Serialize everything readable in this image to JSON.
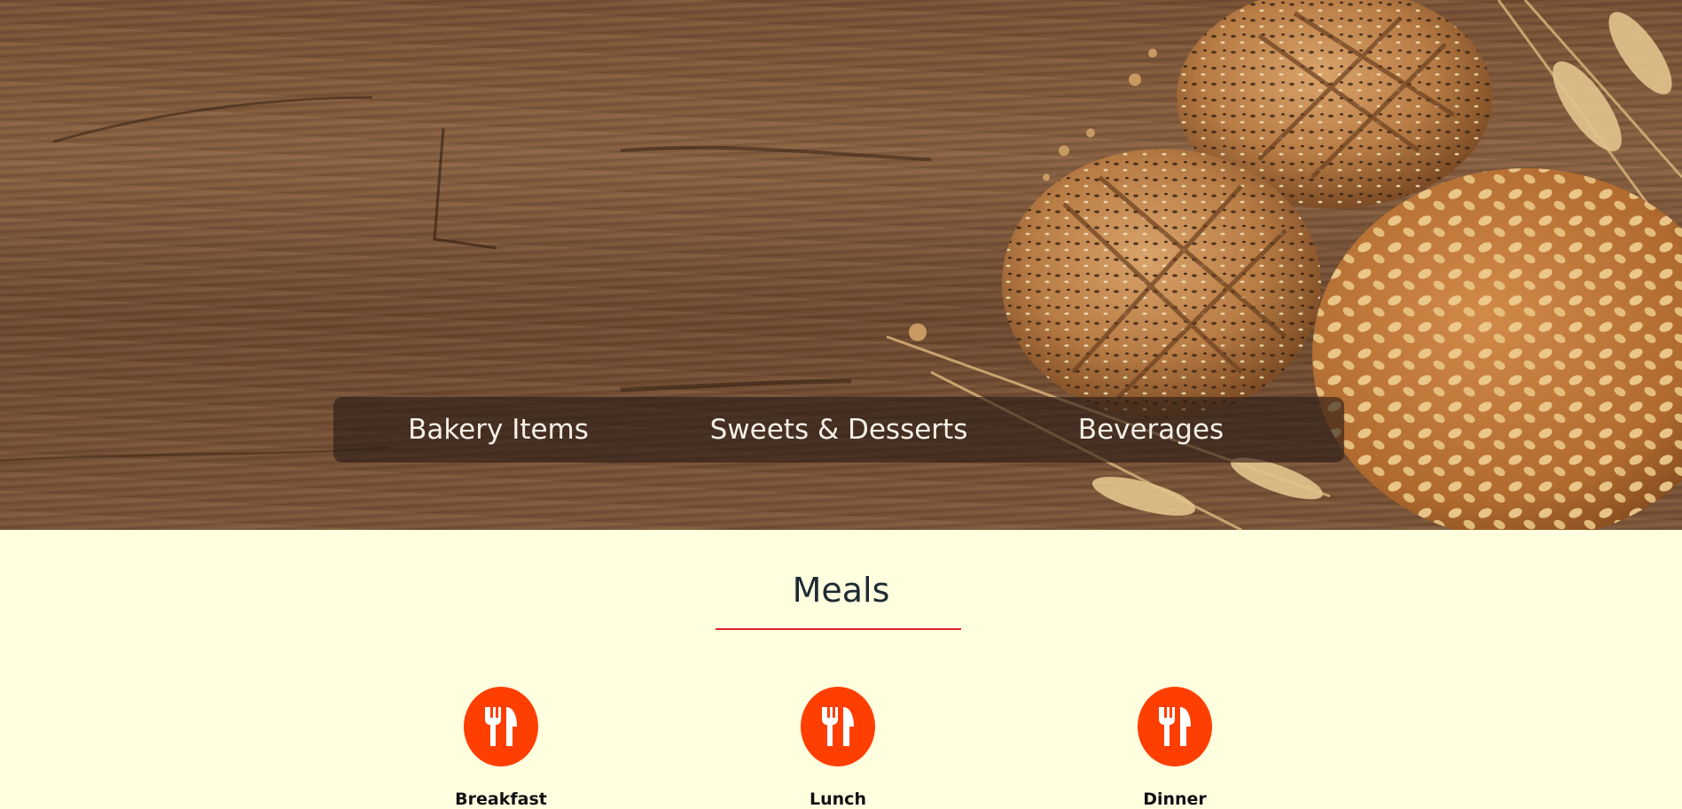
{
  "hero": {
    "image": "bread-loaves-on-wooden-table-with-wheat",
    "nav_links": [
      {
        "label": "Bakery Items"
      },
      {
        "label": "Sweets & Desserts"
      },
      {
        "label": "Beverages"
      }
    ]
  },
  "meals_section": {
    "title": "Meals",
    "accent_color": "#e0262a",
    "icon_color": "#ff3e02",
    "items": [
      {
        "label": "Breakfast",
        "icon": "utensils-icon"
      },
      {
        "label": "Lunch",
        "icon": "utensils-icon"
      },
      {
        "label": "Dinner",
        "icon": "utensils-icon"
      }
    ]
  }
}
